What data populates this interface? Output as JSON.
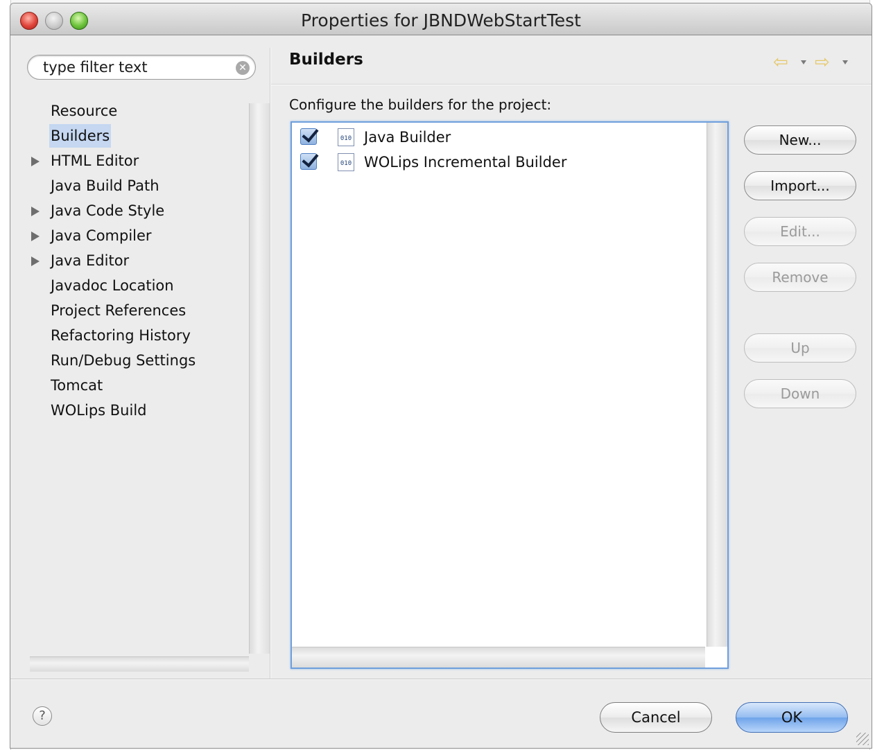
{
  "window": {
    "title": "Properties for JBNDWebStartTest"
  },
  "filter": {
    "placeholder": "type filter text"
  },
  "tree": {
    "items": [
      {
        "label": "Resource",
        "expandable": false,
        "selected": false
      },
      {
        "label": "Builders",
        "expandable": false,
        "selected": true
      },
      {
        "label": "HTML Editor",
        "expandable": true,
        "selected": false
      },
      {
        "label": "Java Build Path",
        "expandable": false,
        "selected": false
      },
      {
        "label": "Java Code Style",
        "expandable": true,
        "selected": false
      },
      {
        "label": "Java Compiler",
        "expandable": true,
        "selected": false
      },
      {
        "label": "Java Editor",
        "expandable": true,
        "selected": false
      },
      {
        "label": "Javadoc Location",
        "expandable": false,
        "selected": false
      },
      {
        "label": "Project References",
        "expandable": false,
        "selected": false
      },
      {
        "label": "Refactoring History",
        "expandable": false,
        "selected": false
      },
      {
        "label": "Run/Debug Settings",
        "expandable": false,
        "selected": false
      },
      {
        "label": "Tomcat",
        "expandable": false,
        "selected": false
      },
      {
        "label": "WOLips Build",
        "expandable": false,
        "selected": false
      }
    ]
  },
  "page": {
    "title": "Builders",
    "config_label": "Configure the builders for the project:",
    "builders": [
      {
        "name": "Java Builder",
        "checked": true,
        "icon": "010"
      },
      {
        "name": "WOLips Incremental Builder",
        "checked": true,
        "icon": "010"
      }
    ],
    "buttons": {
      "new": "New...",
      "import": "Import...",
      "edit": "Edit...",
      "remove": "Remove",
      "up": "Up",
      "down": "Down"
    }
  },
  "footer": {
    "help": "?",
    "cancel": "Cancel",
    "ok": "OK"
  },
  "colors": {
    "selection": "#c5d7f1",
    "focus_ring": "#6f9fdc",
    "nav_arrow": "#e6c86a"
  }
}
